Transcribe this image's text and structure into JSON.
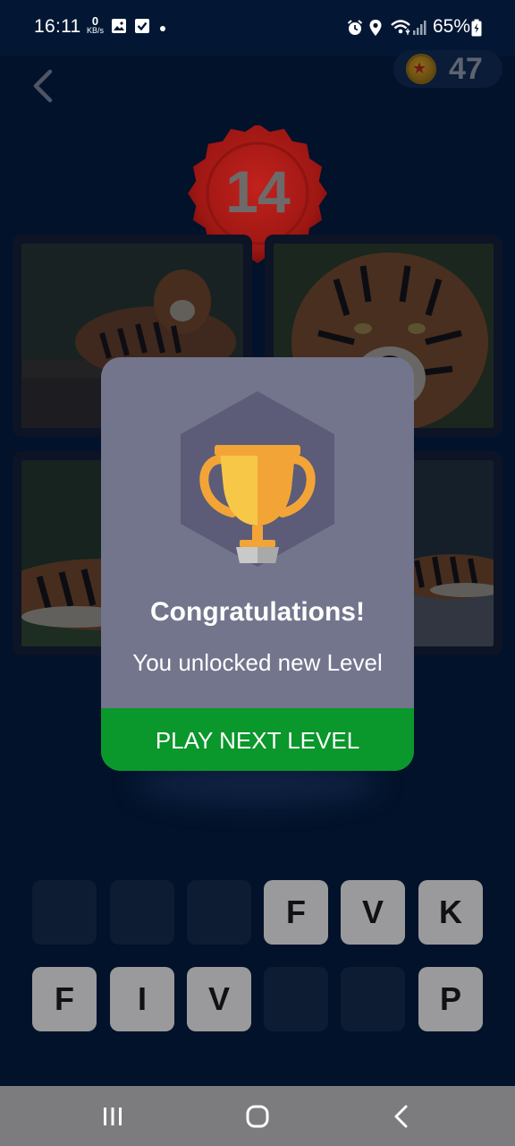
{
  "status_bar": {
    "time": "16:11",
    "net_speed_value": "0",
    "net_speed_unit": "KB/s",
    "battery": "65%"
  },
  "header": {
    "coins": "47",
    "level": "14"
  },
  "dialog": {
    "title": "Congratulations!",
    "message": "You unlocked new Level",
    "button_label": "PLAY NEXT LEVEL"
  },
  "letter_slots": {
    "row1": [
      "",
      "",
      "",
      "F",
      "V",
      "K"
    ],
    "row2": [
      "F",
      "I",
      "V",
      "",
      "",
      "P"
    ]
  },
  "colors": {
    "background": "#02122a",
    "badge_red": "#c0201d",
    "dialog_bg": "#73758d",
    "button_green": "#0a972b",
    "trophy_gold": "#f7c748"
  },
  "icons": {
    "back": "chevron-left-icon",
    "coin": "coin-star-icon",
    "trophy": "trophy-icon"
  }
}
